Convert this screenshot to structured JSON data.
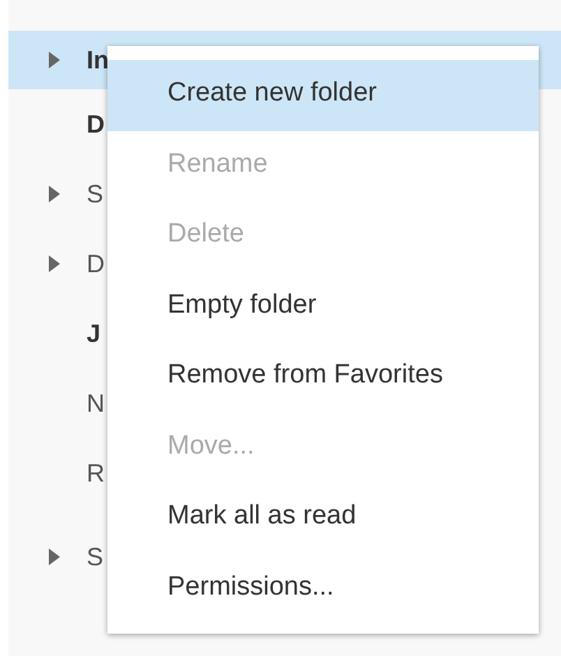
{
  "folders": [
    {
      "label": "In",
      "bold": true,
      "expandable": true,
      "selected": true
    },
    {
      "label": "D",
      "bold": true,
      "expandable": false,
      "selected": false
    },
    {
      "label": "S",
      "bold": false,
      "expandable": true,
      "selected": false
    },
    {
      "label": "D",
      "bold": false,
      "expandable": true,
      "selected": false
    },
    {
      "label": "J",
      "bold": true,
      "expandable": false,
      "selected": false
    },
    {
      "label": "N",
      "bold": false,
      "expandable": false,
      "selected": false
    },
    {
      "label": "R",
      "bold": false,
      "expandable": false,
      "selected": false
    },
    {
      "label": "S",
      "bold": false,
      "expandable": true,
      "selected": false
    }
  ],
  "context_menu": {
    "items": [
      {
        "label": "Create new folder",
        "disabled": false,
        "selected": true
      },
      {
        "label": "Rename",
        "disabled": true,
        "selected": false
      },
      {
        "label": "Delete",
        "disabled": true,
        "selected": false
      },
      {
        "label": "Empty folder",
        "disabled": false,
        "selected": false
      },
      {
        "label": "Remove from Favorites",
        "disabled": false,
        "selected": false
      },
      {
        "label": "Move...",
        "disabled": true,
        "selected": false
      },
      {
        "label": "Mark all as read",
        "disabled": false,
        "selected": false
      },
      {
        "label": "Permissions...",
        "disabled": false,
        "selected": false
      }
    ]
  }
}
